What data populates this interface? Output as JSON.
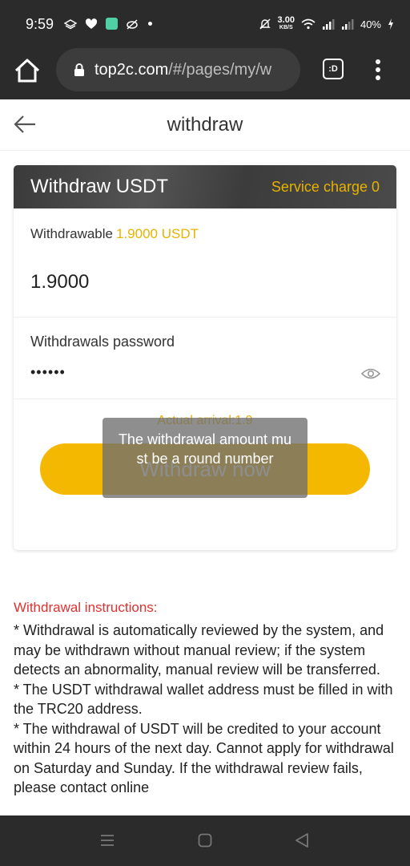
{
  "status_bar": {
    "time": "9:59",
    "speed_value": "3.00",
    "speed_unit": "KB/S",
    "battery": "40%",
    "icons": [
      "layers-icon",
      "top2-app-icon",
      "green-app-icon",
      "eye-slash-icon",
      "dot-icon",
      "bell-off-icon",
      "wifi-icon",
      "signal-icon",
      "signal-icon-2",
      "charging-icon"
    ]
  },
  "browser": {
    "url_domain": "top2c.com",
    "url_path": "/#/pages/my/w",
    "tabs_label": ":D"
  },
  "header": {
    "title": "withdraw"
  },
  "card": {
    "title": "Withdraw USDT",
    "service_charge": "Service charge 0",
    "withdrawable_label": "Withdrawable",
    "withdrawable_value": "1.9000 USDT",
    "amount_value": "1.9000",
    "password_label": "Withdrawals password",
    "password_value": "••••••",
    "actual_arrival": "Actual arrival:1.9",
    "submit_label": "Withdraw now"
  },
  "toast": {
    "message": "The withdrawal amount must be a round number"
  },
  "instructions": {
    "title": "Withdrawal instructions:",
    "lines": [
      "* Withdrawal is automatically reviewed by the system, and may be withdrawn without manual review; if the system detects an abnormality, manual review will be transferred.",
      "* The USDT withdrawal wallet address must be filled in with the TRC20 address.",
      "* The withdrawal of USDT will be credited to your account within 24 hours of the next day. Cannot apply for withdrawal on Saturday and Sunday. If the withdrawal review fails, please contact online"
    ]
  },
  "colors": {
    "accent": "#f5b800",
    "accent_text": "#e7b200",
    "danger": "#e03030",
    "dark_bar": "#2b2b2b"
  }
}
